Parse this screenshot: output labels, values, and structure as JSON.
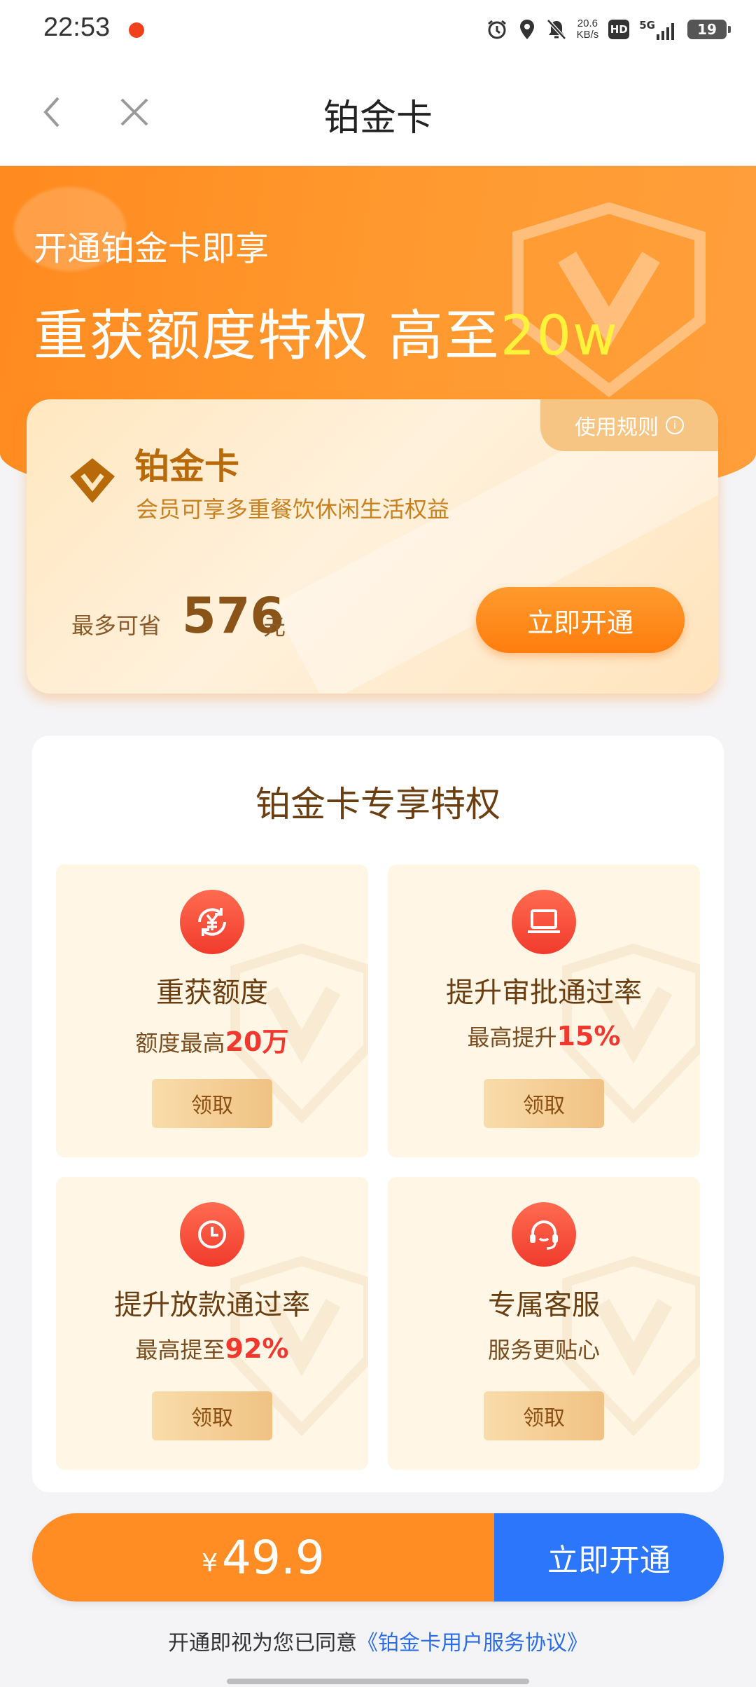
{
  "status_bar": {
    "time": "22:53",
    "net_speed_value": "20.6",
    "net_speed_unit": "KB/s",
    "hd_label": "HD",
    "network_label": "5G",
    "battery": "19",
    "icons": [
      "alarm-icon",
      "location-icon",
      "mute-icon",
      "signal-icon",
      "battery-icon"
    ]
  },
  "nav": {
    "title": "铂金卡",
    "icons": [
      "back-icon",
      "close-icon"
    ]
  },
  "hero": {
    "subtitle": "开通铂金卡即享",
    "title_main": "重获额度特权 高至",
    "title_highlight": "20w"
  },
  "card": {
    "rules_label": "使用规则",
    "name": "铂金卡",
    "description": "会员可享多重餐饮休闲生活权益",
    "save_label": "最多可省",
    "save_amount": "576",
    "save_unit": "元",
    "button_label": "立即开通"
  },
  "privileges": {
    "title": "铂金卡专享特权",
    "items": [
      {
        "icon": "yuan-refresh-icon",
        "name": "重获额度",
        "desc_prefix": "额度最高",
        "desc_highlight": "20万",
        "button": "领取"
      },
      {
        "icon": "laptop-icon",
        "name": "提升审批通过率",
        "desc_prefix": "最高提升",
        "desc_highlight": "15%",
        "button": "领取"
      },
      {
        "icon": "clock-icon",
        "name": "提升放款通过率",
        "desc_prefix": "最高提至",
        "desc_highlight": "92%",
        "button": "领取"
      },
      {
        "icon": "headset-icon",
        "name": "专属客服",
        "desc_prefix": "服务更贴心",
        "desc_highlight": "",
        "button": "领取"
      }
    ]
  },
  "purchase": {
    "currency": "¥",
    "price": "49.9",
    "button_label": "立即开通"
  },
  "agreement": {
    "text": "开通即视为您已同意",
    "link": "《铂金卡用户服务协议》"
  },
  "colors": {
    "brand_orange": "#ff8d24",
    "action_blue": "#2b76fb",
    "highlight_yellow": "#fff23a",
    "accent_red": "#f0382e"
  }
}
